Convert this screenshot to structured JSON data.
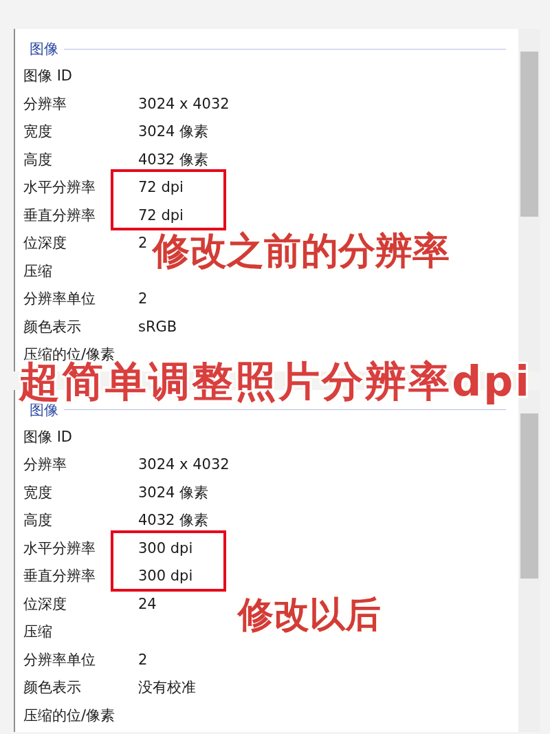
{
  "panels": [
    {
      "section_header": "图像",
      "items": [
        {
          "kind": "property",
          "name": "图像 ID"
        },
        {
          "kind": "property",
          "name": "分辨率",
          "value": "3024 x 4032"
        },
        {
          "kind": "property",
          "name": "宽度",
          "value": "3024 像素"
        },
        {
          "kind": "property",
          "name": "高度",
          "value": "4032 像素"
        },
        {
          "kind": "highlighted_group",
          "rows": [
            {
              "name": "水平分辨率",
              "value": "72 dpi"
            },
            {
              "name": "垂直分辨率",
              "value": "72 dpi"
            }
          ]
        },
        {
          "kind": "property",
          "name": "位深度",
          "value": "2"
        },
        {
          "kind": "property",
          "name": "压缩"
        },
        {
          "kind": "property",
          "name": "分辨率单位",
          "value": "2"
        },
        {
          "kind": "property",
          "name": "颜色表示",
          "value": "sRGB"
        },
        {
          "kind": "property",
          "name": "压缩的位/像素"
        }
      ],
      "note": "修改之前的分辨率"
    },
    {
      "section_header": "图像",
      "items": [
        {
          "kind": "property",
          "name": "图像 ID"
        },
        {
          "kind": "property",
          "name": "分辨率",
          "value": "3024 x 4032"
        },
        {
          "kind": "property",
          "name": "宽度",
          "value": "3024 像素"
        },
        {
          "kind": "property",
          "name": "高度",
          "value": "4032 像素"
        },
        {
          "kind": "highlighted_group",
          "rows": [
            {
              "name": "水平分辨率",
              "value": "300 dpi"
            },
            {
              "name": "垂直分辨率",
              "value": "300 dpi"
            }
          ]
        },
        {
          "kind": "property",
          "name": "位深度",
          "value": "24"
        },
        {
          "kind": "property",
          "name": "压缩"
        },
        {
          "kind": "property",
          "name": "分辨率单位",
          "value": "2"
        },
        {
          "kind": "property",
          "name": "颜色表示",
          "value": "没有校准"
        },
        {
          "kind": "property",
          "name": "压缩的位/像素"
        }
      ],
      "note": "修改以后"
    }
  ],
  "title": "超简单调整照片分辨率dpi"
}
